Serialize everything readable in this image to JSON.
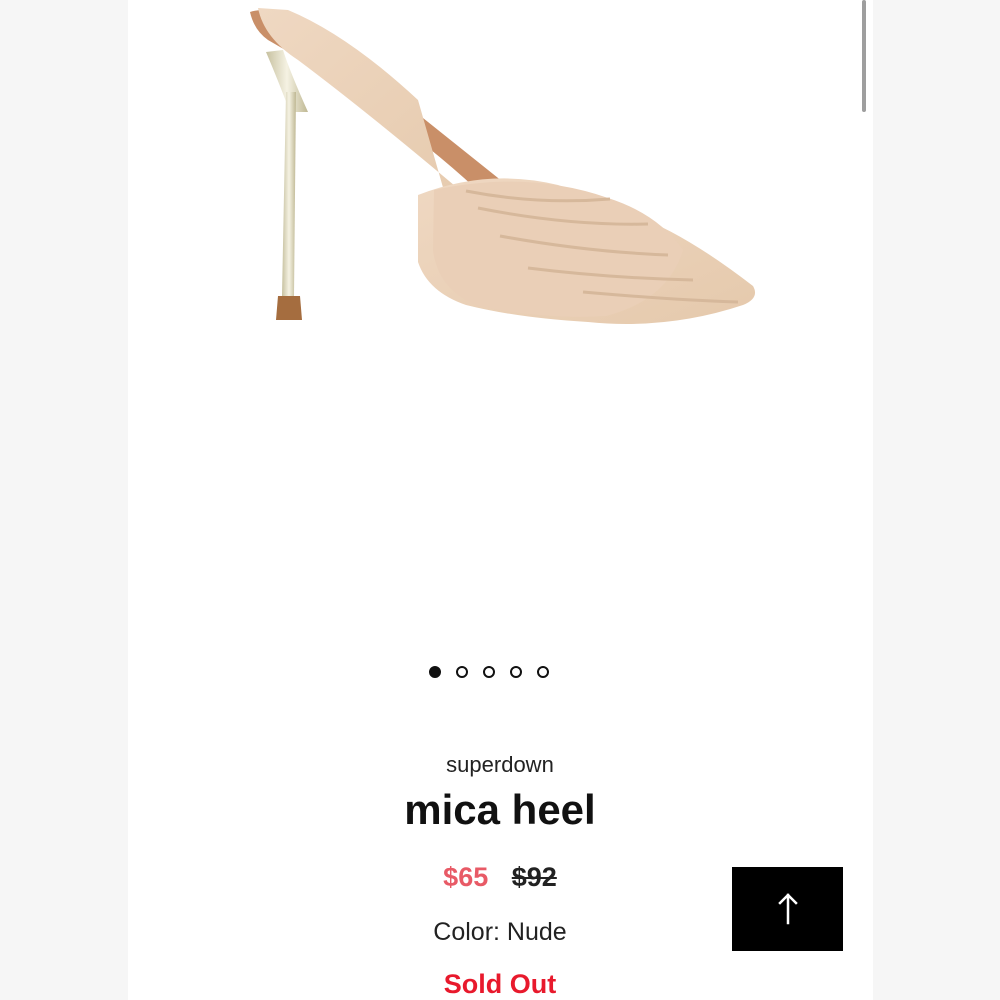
{
  "product": {
    "brand": "superdown",
    "name": "mica heel",
    "sale_price": "$65",
    "original_price": "$92",
    "color_label": "Color: Nude",
    "status": "Sold Out",
    "image_icon": "high-heel-mule-image"
  },
  "carousel": {
    "count": 5,
    "active_index": 0
  },
  "back_to_top": {
    "icon": "arrow-up-icon"
  },
  "colors": {
    "sale": "#e85a66",
    "sold_out": "#e8192c",
    "button_bg": "#000000"
  }
}
